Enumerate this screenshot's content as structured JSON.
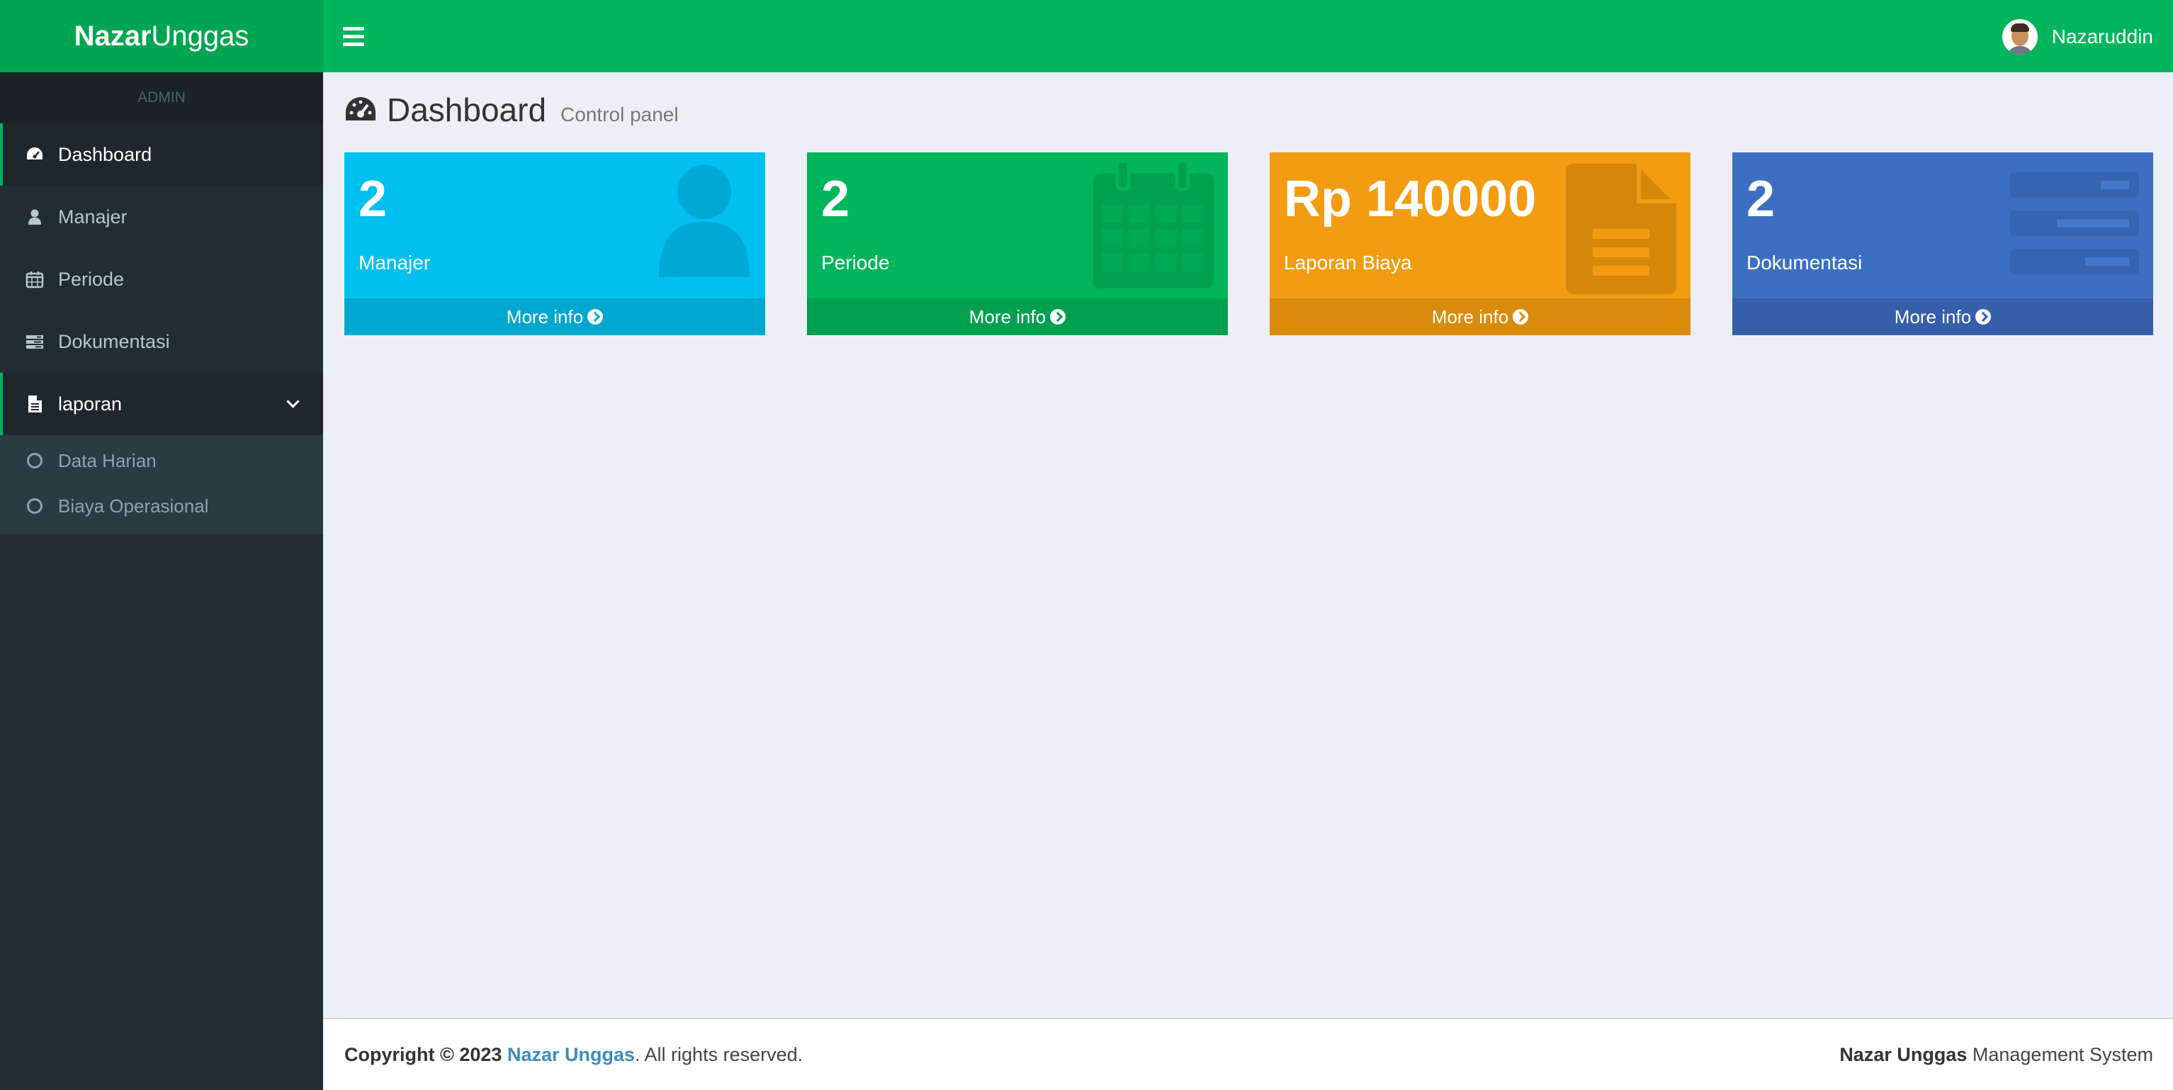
{
  "brand": {
    "bold": "Nazar",
    "light": "Unggas"
  },
  "user": {
    "name": "Nazaruddin"
  },
  "sidebar": {
    "header": "ADMIN",
    "items": [
      {
        "label": "Dashboard",
        "icon": "dashboard-icon"
      },
      {
        "label": "Manajer",
        "icon": "user-icon"
      },
      {
        "label": "Periode",
        "icon": "calendar-icon"
      },
      {
        "label": "Dokumentasi",
        "icon": "server-icon"
      },
      {
        "label": "laporan",
        "icon": "file-icon"
      }
    ],
    "submenu": [
      {
        "label": "Data Harian"
      },
      {
        "label": "Biaya Operasional"
      }
    ]
  },
  "page": {
    "title": "Dashboard",
    "subtitle": "Control panel"
  },
  "boxes": [
    {
      "value": "2",
      "label": "Manajer",
      "footer": "More info",
      "color": "#00c0ef",
      "icon": "user-icon"
    },
    {
      "value": "2",
      "label": "Periode",
      "footer": "More info",
      "color": "#00b55c",
      "icon": "calendar-icon"
    },
    {
      "value": "Rp 140000",
      "label": "Laporan Biaya",
      "footer": "More info",
      "color": "#f39c12",
      "icon": "document-icon"
    },
    {
      "value": "2",
      "label": "Dokumentasi",
      "footer": "More info",
      "color": "#3c6fc2",
      "icon": "server-icon"
    }
  ],
  "footer": {
    "copyright": "Copyright © 2023",
    "company": "Nazar Unggas",
    "rights": ". All rights reserved.",
    "system_bold": "Nazar Unggas",
    "system_rest": " Management System"
  },
  "colors": {
    "brand_green": "#00b55c",
    "sidebar_bg": "#222d32",
    "content_bg": "#ecf0f5"
  }
}
